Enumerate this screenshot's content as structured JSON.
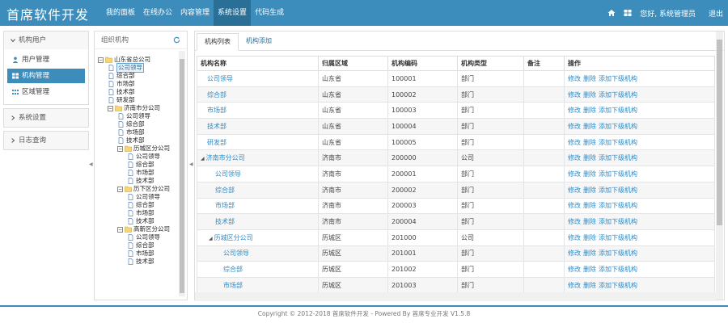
{
  "brand": "首席软件开发",
  "topnav": [
    "我的面板",
    "在线办公",
    "内容管理",
    "系统设置",
    "代码生成"
  ],
  "topnav_active": 3,
  "user_greeting": "您好, 系统管理员",
  "logout": "退出",
  "left_menu": {
    "group1": {
      "title": "机构用户",
      "items": [
        "用户管理",
        "机构管理",
        "区域管理"
      ],
      "active": 1
    },
    "group2": {
      "title": "系统设置"
    },
    "group3": {
      "title": "日志查询"
    }
  },
  "tree": {
    "title": "组织机构",
    "nodes": [
      {
        "label": "山东省总公司",
        "level": 0,
        "type": "folder"
      },
      {
        "label": "公司领导",
        "level": 1,
        "type": "file",
        "selected": true
      },
      {
        "label": "综合部",
        "level": 1,
        "type": "file"
      },
      {
        "label": "市场部",
        "level": 1,
        "type": "file"
      },
      {
        "label": "技术部",
        "level": 1,
        "type": "file"
      },
      {
        "label": "研发部",
        "level": 1,
        "type": "file"
      },
      {
        "label": "济南市分公司",
        "level": 1,
        "type": "folder"
      },
      {
        "label": "公司领导",
        "level": 2,
        "type": "file"
      },
      {
        "label": "综合部",
        "level": 2,
        "type": "file"
      },
      {
        "label": "市场部",
        "level": 2,
        "type": "file"
      },
      {
        "label": "技术部",
        "level": 2,
        "type": "file"
      },
      {
        "label": "历城区分公司",
        "level": 2,
        "type": "folder"
      },
      {
        "label": "公司领导",
        "level": 3,
        "type": "file"
      },
      {
        "label": "综合部",
        "level": 3,
        "type": "file"
      },
      {
        "label": "市场部",
        "level": 3,
        "type": "file"
      },
      {
        "label": "技术部",
        "level": 3,
        "type": "file"
      },
      {
        "label": "历下区分公司",
        "level": 2,
        "type": "folder"
      },
      {
        "label": "公司领导",
        "level": 3,
        "type": "file"
      },
      {
        "label": "综合部",
        "level": 3,
        "type": "file"
      },
      {
        "label": "市场部",
        "level": 3,
        "type": "file"
      },
      {
        "label": "技术部",
        "level": 3,
        "type": "file"
      },
      {
        "label": "高新区分公司",
        "level": 2,
        "type": "folder"
      },
      {
        "label": "公司领导",
        "level": 3,
        "type": "file"
      },
      {
        "label": "综合部",
        "level": 3,
        "type": "file"
      },
      {
        "label": "市场部",
        "level": 3,
        "type": "file"
      },
      {
        "label": "技术部",
        "level": 3,
        "type": "file"
      }
    ]
  },
  "tabs": [
    "机构列表",
    "机构添加"
  ],
  "table": {
    "headers": [
      "机构名称",
      "归属区域",
      "机构编码",
      "机构类型",
      "备注",
      "操作"
    ],
    "ops": [
      "修改",
      "删除",
      "添加下级机构"
    ],
    "rows": [
      {
        "name": "公司领导",
        "indent": 0,
        "caret": false,
        "area": "山东省",
        "code": "100001",
        "type": "部门"
      },
      {
        "name": "综合部",
        "indent": 0,
        "caret": false,
        "area": "山东省",
        "code": "100002",
        "type": "部门"
      },
      {
        "name": "市场部",
        "indent": 0,
        "caret": false,
        "area": "山东省",
        "code": "100003",
        "type": "部门"
      },
      {
        "name": "技术部",
        "indent": 0,
        "caret": false,
        "area": "山东省",
        "code": "100004",
        "type": "部门"
      },
      {
        "name": "研发部",
        "indent": 0,
        "caret": false,
        "area": "山东省",
        "code": "100005",
        "type": "部门"
      },
      {
        "name": "济南市分公司",
        "indent": 0,
        "caret": true,
        "area": "济南市",
        "code": "200000",
        "type": "公司"
      },
      {
        "name": "公司领导",
        "indent": 1,
        "caret": false,
        "area": "济南市",
        "code": "200001",
        "type": "部门"
      },
      {
        "name": "综合部",
        "indent": 1,
        "caret": false,
        "area": "济南市",
        "code": "200002",
        "type": "部门"
      },
      {
        "name": "市场部",
        "indent": 1,
        "caret": false,
        "area": "济南市",
        "code": "200003",
        "type": "部门"
      },
      {
        "name": "技术部",
        "indent": 1,
        "caret": false,
        "area": "济南市",
        "code": "200004",
        "type": "部门"
      },
      {
        "name": "历城区分公司",
        "indent": 1,
        "caret": true,
        "area": "历城区",
        "code": "201000",
        "type": "公司"
      },
      {
        "name": "公司领导",
        "indent": 2,
        "caret": false,
        "area": "历城区",
        "code": "201001",
        "type": "部门"
      },
      {
        "name": "综合部",
        "indent": 2,
        "caret": false,
        "area": "历城区",
        "code": "201002",
        "type": "部门"
      },
      {
        "name": "市场部",
        "indent": 2,
        "caret": false,
        "area": "历城区",
        "code": "201003",
        "type": "部门"
      }
    ]
  },
  "footer": "Copyright © 2012-2018 首席软件开发 - Powered By 首席专业开发 V1.5.8",
  "colors": {
    "primary": "#3c8dbc",
    "link": "#2a8ac8"
  }
}
